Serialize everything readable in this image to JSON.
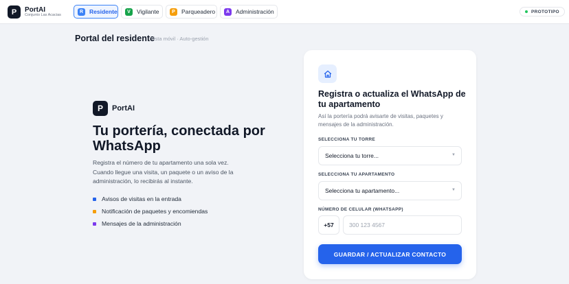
{
  "brand": {
    "logo_letter": "P",
    "name": "PortAI",
    "subtitle": "Conjunto Las Acacias"
  },
  "tabs": [
    {
      "badge": "R",
      "label": "Residente",
      "color": "#3b82f6",
      "active": true
    },
    {
      "badge": "V",
      "label": "Vigilante",
      "color": "#16a34a",
      "active": false
    },
    {
      "badge": "P",
      "label": "Parqueadero",
      "color": "#f59e0b",
      "active": false
    },
    {
      "badge": "A",
      "label": "Administración",
      "color": "#7c3aed",
      "active": false
    }
  ],
  "status_badge": "PROTOTIPO",
  "page": {
    "title": "Portal del residente",
    "subtitle": "Vista móvil · Auto-gestión"
  },
  "hero": {
    "logo_letter": "P",
    "brand": "PortAI",
    "title": "Tu portería, conectada por WhatsApp",
    "description": "Registra el número de tu apartamento una sola vez. Cuando llegue una visita, un paquete o un aviso de la administración, lo recibirás al instante.",
    "bullets": [
      {
        "text": "Avisos de visitas en la entrada",
        "color": "#2563eb"
      },
      {
        "text": "Notificación de paquetes y encomiendas",
        "color": "#f59e0b"
      },
      {
        "text": "Mensajes de la administración",
        "color": "#7c3aed"
      }
    ]
  },
  "form": {
    "icon": "home-icon",
    "title": "Registra o actualiza el WhatsApp de tu apartamento",
    "description": "Así la portería podrá avisarte de visitas, paquetes y mensajes de la administración.",
    "tower_label": "SELECCIONA TU TORRE",
    "tower_value": "Selecciona tu torre...",
    "apartment_label": "SELECCIONA TU APARTAMENTO",
    "apartment_value": "Selecciona tu apartamento...",
    "phone_label": "NÚMERO DE CELULAR (WHATSAPP)",
    "phone_prefix": "+57",
    "phone_placeholder": "300 123 4567",
    "submit_label": "GUARDAR / ACTUALIZAR CONTACTO"
  },
  "colors": {
    "accent": "#2563eb",
    "status_dot": "#22c55e",
    "background": "#f1f3f7"
  }
}
